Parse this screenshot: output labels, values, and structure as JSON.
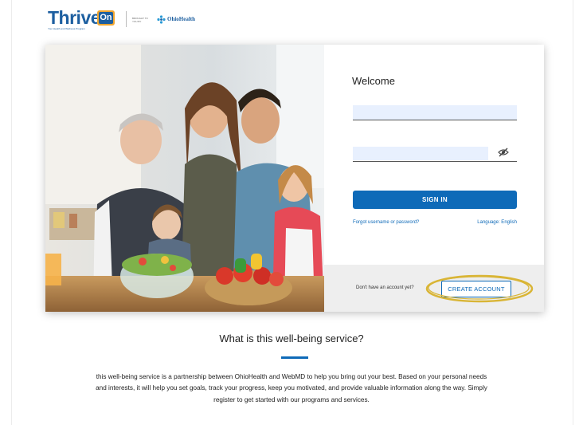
{
  "brand": {
    "logo_text": "Thrive",
    "logo_badge": "On",
    "tagline": "Your Health and Wellness Program",
    "sponsor_note": "BROUGHT TO YOU BY",
    "sponsor_name": "OhioHealth"
  },
  "login": {
    "welcome": "Welcome",
    "username_value": "",
    "password_value": "",
    "sign_in_label": "SIGN IN",
    "forgot_label": "Forgot username or password?",
    "language_label": "Language: English",
    "no_account_text": "Don't have an account yet?",
    "create_account_label": "CREATE ACCOUNT"
  },
  "info": {
    "title": "What is this well-being service?",
    "description": "this well-being service is a partnership between OhioHealth and WebMD to help you bring out your best. Based on your personal needs and interests, it will help you set goals, track your progress, keep you motivated, and provide valuable information along the way. Simply register to get started with our programs and services."
  },
  "colors": {
    "brand_blue": "#1d5fa0",
    "button_blue": "#0e6ab8",
    "badge_orange": "#f0a630",
    "highlight_gold": "#d9b536"
  },
  "icons": {
    "password_toggle": "eye-slash-icon",
    "sponsor_logo": "ohiohealth-icon"
  }
}
